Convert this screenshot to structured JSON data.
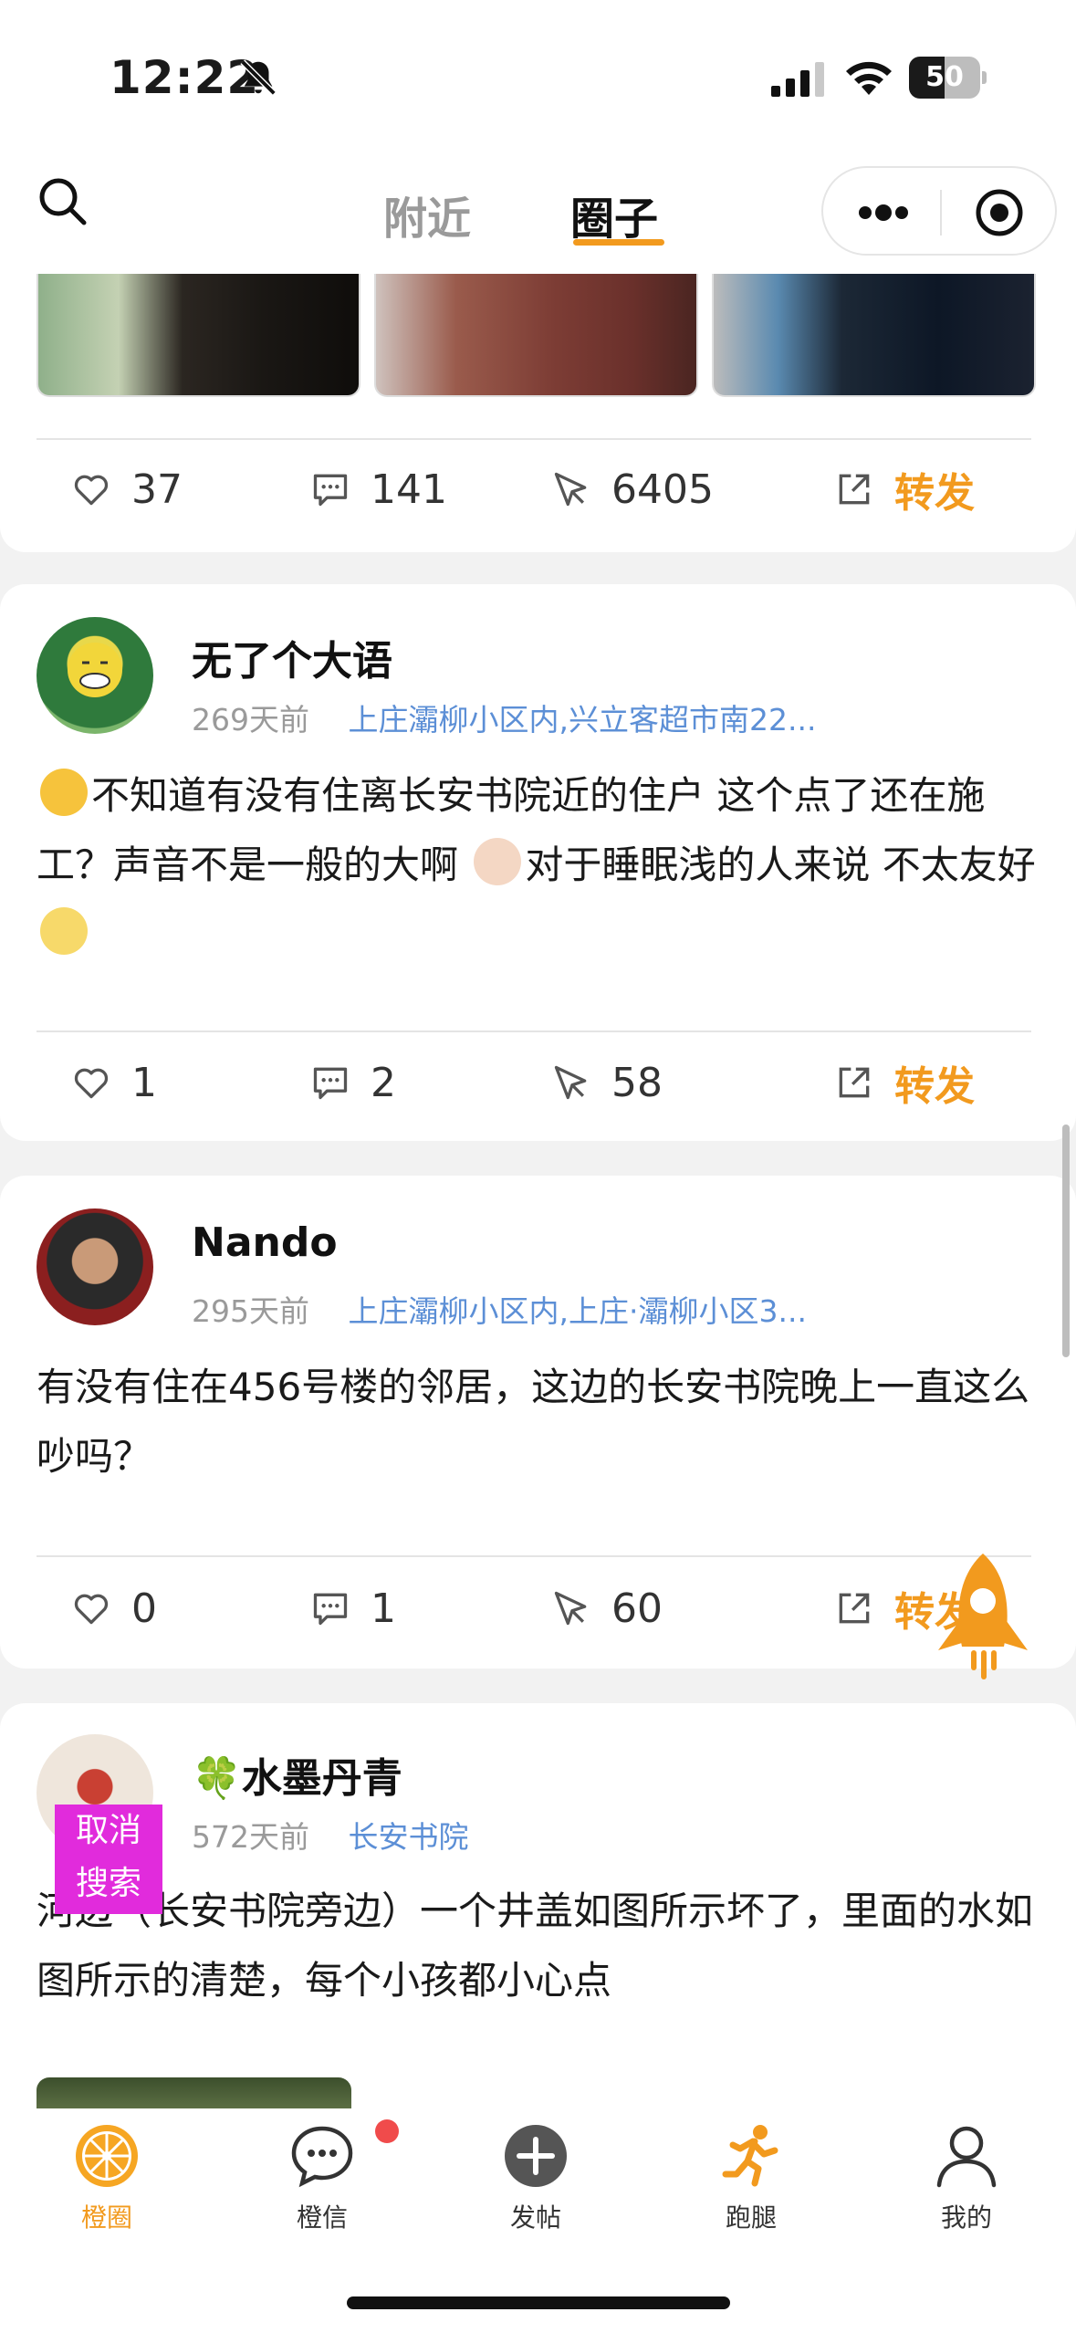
{
  "status_bar": {
    "time": "12:22",
    "battery": "50",
    "battery_level": 0.5
  },
  "top_nav": {
    "tab_nearby": "附近",
    "tab_circle": "圈子",
    "active_tab": "圈子"
  },
  "posts": [
    {
      "stats": {
        "likes": "37",
        "comments": "141",
        "views": "6405",
        "share": "转发"
      }
    },
    {
      "author": "无了个大语",
      "time": "269天前",
      "location": "上庄灞柳小区内,兴立客超市南22...",
      "text_a": "不知道有没有住离长安书院近的住户 这个点了还在施工？声音不是一般的大啊",
      "text_b": "对于睡眠浅的人来说 不太友好",
      "stats": {
        "likes": "1",
        "comments": "2",
        "views": "58",
        "share": "转发"
      }
    },
    {
      "author": "Nando",
      "time": "295天前",
      "location": "上庄灞柳小区内,上庄·灞柳小区3...",
      "text": "有没有住在456号楼的邻居，这边的长安书院晚上一直这么吵吗？",
      "stats": {
        "likes": "0",
        "comments": "1",
        "views": "60",
        "share": "转发"
      }
    },
    {
      "author_icon": "🍀",
      "author": "水墨丹青",
      "time": "572天前",
      "location": "长安书院",
      "text": "河边（长安书院旁边）一个井盖如图所示坏了，里面的水如图所示的清楚，每个小孩都小心点"
    }
  ],
  "overlay": {
    "cancel_search_line1": "取消",
    "cancel_search_line2": "搜索"
  },
  "tab_bar": {
    "home": "橙圈",
    "messages": "橙信",
    "post": "发帖",
    "errand": "跑腿",
    "mine": "我的"
  },
  "colors": {
    "accent": "#f29a1e",
    "location_link": "#5c8fd6",
    "badge": "#f04b4b"
  }
}
